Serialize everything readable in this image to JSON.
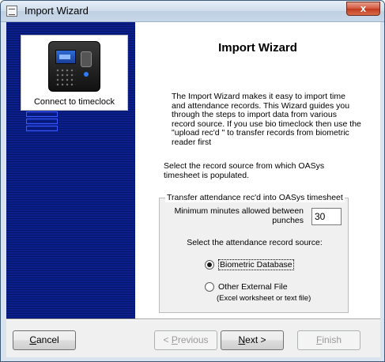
{
  "window": {
    "title": "Import Wizard",
    "close_glyph": "x"
  },
  "sidebar": {
    "card_caption": "Connect to timeclock",
    "card_image": "timeclock-device-icon",
    "list_icon": "list-icon"
  },
  "main": {
    "heading": "Import Wizard",
    "intro": "The Import Wizard makes it easy to import time and attendance records. This Wizard guides you through the steps to import data from various record source. If you use bio timeclock then use the \"upload rec'd \" to transfer records from biometric reader first",
    "select_source_text": "Select the record source from which OASys timesheet is populated."
  },
  "group": {
    "legend": "Transfer attendance rec'd into OASys timesheet",
    "min_minutes_label": "Minimum minutes allowed between punches",
    "min_minutes_value": "30",
    "source_label": "Select the attendance record source:",
    "options": [
      {
        "label": "Biometric Database",
        "selected": true
      },
      {
        "label": "Other External File",
        "selected": false
      }
    ],
    "option_hint": "(Excel worksheet or text  file)"
  },
  "buttons": {
    "cancel_first": "C",
    "cancel_rest": "ancel",
    "previous_prefix": "< ",
    "previous_ul": "P",
    "previous_rest": "revious",
    "next_ul": "N",
    "next_rest": "ext >",
    "finish_ul": "F",
    "finish_rest": "inish"
  }
}
